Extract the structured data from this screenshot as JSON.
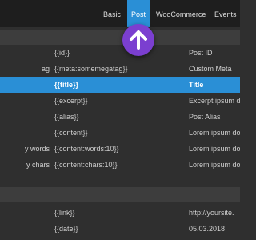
{
  "nav": {
    "tabs": [
      {
        "label": "Basic"
      },
      {
        "label": "Post"
      },
      {
        "label": "WooCommerce"
      },
      {
        "label": "Events"
      }
    ]
  },
  "table": {
    "rows": [
      {
        "name": "",
        "tag": "{{id}}",
        "value": "Post ID"
      },
      {
        "name": "ag",
        "tag": "{{meta:somemegatag}}",
        "value": "Custom Meta"
      },
      {
        "name": "",
        "tag": "{{title}}",
        "value": "Title"
      },
      {
        "name": "",
        "tag": "{{excerpt}}",
        "value": "Excerpt ipsum d"
      },
      {
        "name": "",
        "tag": "{{alias}}",
        "value": "Post Alias"
      },
      {
        "name": "",
        "tag": "{{content}}",
        "value": "Lorem ipsum do"
      },
      {
        "name": "y words",
        "tag": "{{content:words:10}}",
        "value": "Lorem ipsum do"
      },
      {
        "name": "y chars",
        "tag": "{{content:chars:10}}",
        "value": "Lorem ipsum do"
      },
      {
        "name": "",
        "tag": "{{link}}",
        "value": "http://yoursite."
      },
      {
        "name": "",
        "tag": "{{date}}",
        "value": "05.03.2018"
      }
    ],
    "selected_row": 2
  },
  "colors": {
    "accent": "#2a8fd6",
    "badge": "#7b3fd0"
  },
  "icons": {
    "badge": "arrow-up-icon"
  }
}
